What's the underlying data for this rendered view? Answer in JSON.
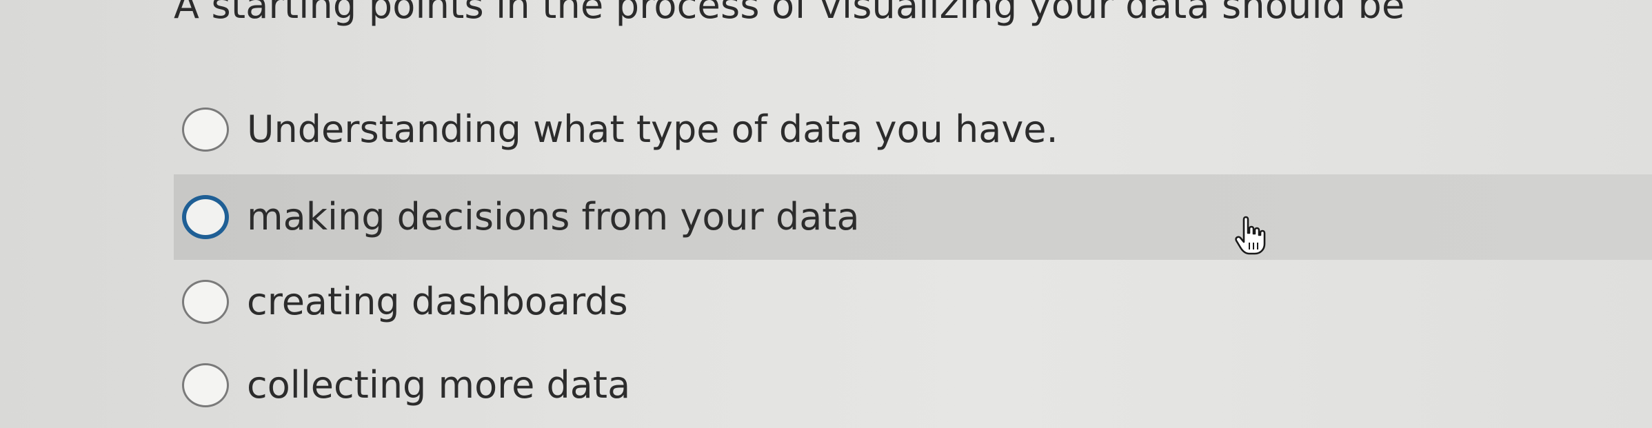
{
  "question": {
    "text": "A starting points in the process of visualizing your data should be"
  },
  "options": [
    {
      "label": "Understanding what type of data you have.",
      "selected": false
    },
    {
      "label": "making decisions from your data",
      "selected": false,
      "hovered": true
    },
    {
      "label": "creating dashboards",
      "selected": false
    },
    {
      "label": "collecting more data",
      "selected": false
    }
  ],
  "cursor": {
    "icon": "hand-pointer-icon"
  }
}
